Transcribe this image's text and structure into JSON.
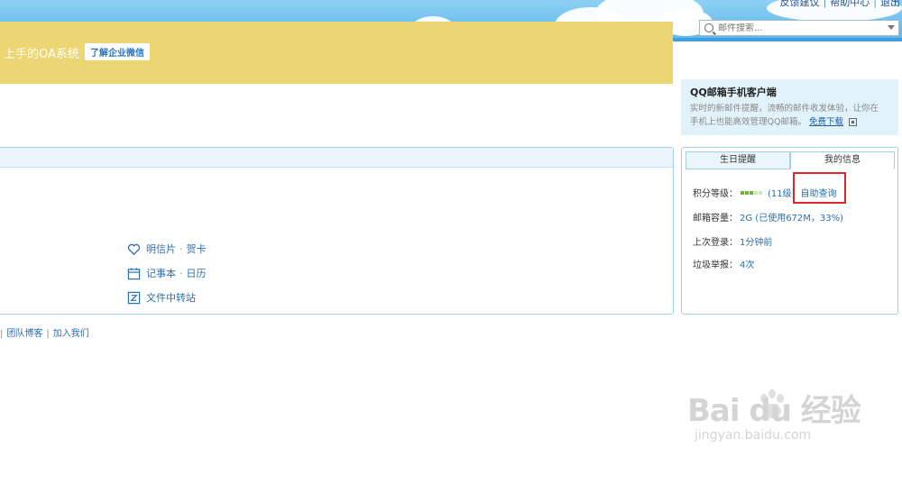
{
  "header": {
    "top_links": [
      "反馈建议",
      "帮助中心",
      "退出"
    ],
    "search_placeholder": "邮件搜索..."
  },
  "promo": {
    "title": "QQ邮箱手机客户端",
    "desc_line1": "实时的新邮件提醒，流畅的邮件收发体验，让你在",
    "desc_line2": "手机上也能高效管理QQ邮箱。",
    "download_link": "免费下载"
  },
  "banner": {
    "text": "上手的OA系统",
    "button": "了解企业微信"
  },
  "tools": [
    {
      "a": "明信片",
      "b": "贺卡",
      "icon": "heart-icon"
    },
    {
      "a": "记事本",
      "b": "日历",
      "icon": "calendar-icon"
    },
    {
      "a": "文件中转站",
      "b": "",
      "icon": "file-transfer-icon"
    }
  ],
  "tabs": [
    "生日提醒",
    "我的信息"
  ],
  "info": {
    "points_label": "积分等级：",
    "points_value": "(11级)",
    "points_link": "自助查询",
    "storage_label": "邮箱容量：",
    "storage_value": "2G (已使用672M，33%)",
    "login_label": "上次登录：",
    "login_value": "1分钟前",
    "spam_label": "垃圾举报：",
    "spam_value": "4次"
  },
  "footer_links": [
    "团队博客",
    "加入我们"
  ],
  "watermark": {
    "brand": "Bai du 经验",
    "url": "jingyan.baidu.com"
  },
  "colors": {
    "accent": "#2a6fb2",
    "banner": "#ecd573",
    "highlight": "#e0252b"
  }
}
